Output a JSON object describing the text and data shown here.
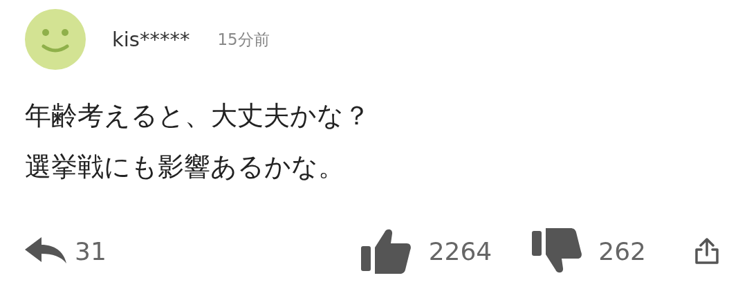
{
  "comment": {
    "user": {
      "name": "kis*****",
      "time": "15分前"
    },
    "lines": [
      "年齢考えると、大丈夫かな？",
      "選挙戦にも影響あるかな。"
    ],
    "actions": [
      {
        "kind": "reply",
        "count": "31"
      },
      {
        "kind": "like",
        "count": "2264"
      },
      {
        "kind": "dislike",
        "count": "262"
      },
      {
        "kind": "share"
      }
    ]
  }
}
